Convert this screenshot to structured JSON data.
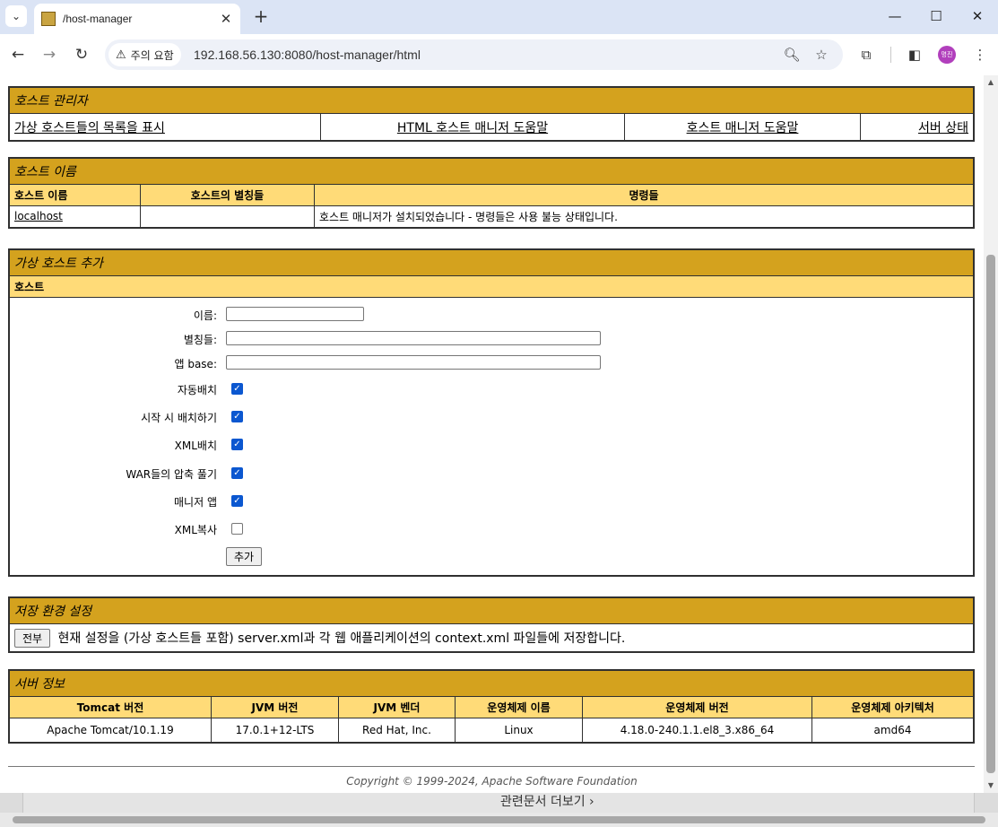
{
  "browser": {
    "tab_title": "/host-manager",
    "security_chip": "주의 요함",
    "url": "192.168.56.130:8080/host-manager/html",
    "profile_initials": "명진"
  },
  "host_manager": {
    "title": "호스트 관리자",
    "links": [
      "가상 호스트들의 목록을 표시",
      "HTML 호스트 매니저 도움말",
      "호스트 매니저 도움말",
      "서버 상태"
    ]
  },
  "host_name": {
    "title": "호스트 이름",
    "columns": [
      "호스트 이름",
      "호스트의 별칭들",
      "명령들"
    ],
    "row": {
      "host": "localhost",
      "aliases": "",
      "commands": "호스트 매니저가 설치되었습니다 - 명령들은 사용 불능 상태입니다."
    }
  },
  "add_host": {
    "title": "가상 호스트 추가",
    "subtitle": "호스트",
    "fields": {
      "name": "이름:",
      "aliases": "별칭들:",
      "app_base": "앱 base:"
    },
    "checkboxes": [
      {
        "label": "자동배치",
        "checked": true
      },
      {
        "label": "시작 시 배치하기",
        "checked": true
      },
      {
        "label": "XML배치",
        "checked": true
      },
      {
        "label": "WAR들의 압축 풀기",
        "checked": true
      },
      {
        "label": "매니저 앱",
        "checked": true
      },
      {
        "label": "XML복사",
        "checked": false
      }
    ],
    "submit": "추가"
  },
  "persist": {
    "title": "저장 환경 설정",
    "button": "전부",
    "text": "현재 설정을 (가상 호스트들 포함) server.xml과 각 웹 애플리케이션의 context.xml 파일들에 저장합니다."
  },
  "server_info": {
    "title": "서버 정보",
    "columns": [
      "Tomcat 버전",
      "JVM 버전",
      "JVM 벤더",
      "운영체제 이름",
      "운영체제 버전",
      "운영체제 아키텍처"
    ],
    "values": [
      "Apache Tomcat/10.1.19",
      "17.0.1+12-LTS",
      "Red Hat, Inc.",
      "Linux",
      "4.18.0-240.1.1.el8_3.x86_64",
      "amd64"
    ]
  },
  "copyright": "Copyright © 1999-2024, Apache Software Foundation",
  "underlying_text": "관련문서 더보기 ›"
}
